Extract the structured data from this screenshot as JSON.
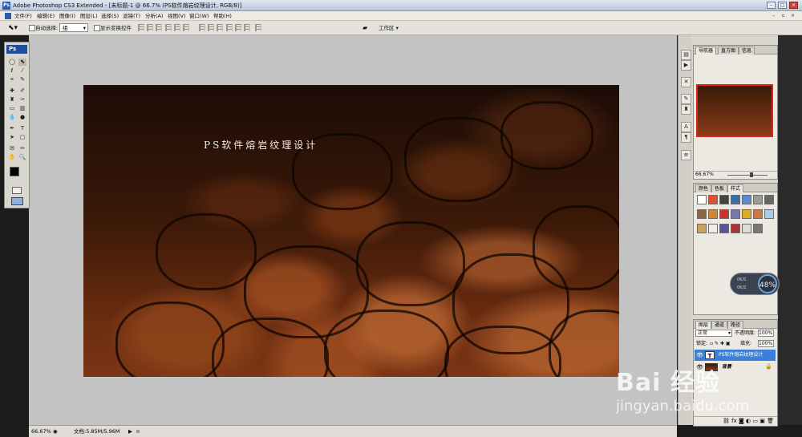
{
  "window": {
    "title": "Adobe Photoshop CS3 Extended - [未标题-1 @ 66.7% (PS软件熔岩纹理设计, RGB/8)]",
    "app_badge": "Ps"
  },
  "menubar": {
    "items": [
      "文件(F)",
      "编辑(E)",
      "图像(I)",
      "图层(L)",
      "选择(S)",
      "滤镜(T)",
      "分析(A)",
      "视图(V)",
      "窗口(W)",
      "帮助(H)"
    ]
  },
  "options": {
    "auto_select_label": "自动选择:",
    "auto_select_value": "组",
    "show_transform_label": "显示变换控件",
    "workspace_label": "工作区 ▾"
  },
  "canvas": {
    "title_text": "PS软件熔岩纹理设计"
  },
  "navigator": {
    "tabs": [
      "导航器",
      "直方图",
      "信息"
    ],
    "zoom": "66.67%"
  },
  "swatches_panel": {
    "tabs": [
      "颜色",
      "色板",
      "样式"
    ],
    "colors": [
      "#ffffff",
      "#e05030",
      "#444444",
      "#3a6ea8",
      "#5a8ad0",
      "#999999",
      "#666666",
      "#886644",
      "#cc8833",
      "#d03030",
      "#7777aa",
      "#ddaa22",
      "#cc7744",
      "#aac8e8",
      "#c8a060",
      "#eeeeee",
      "#555599",
      "#aa3333",
      "#dddddd",
      "#777777"
    ]
  },
  "layers_panel": {
    "tabs": [
      "图层",
      "通道",
      "路径"
    ],
    "blend_mode": "正常",
    "opacity_label": "不透明度:",
    "opacity_value": "100%",
    "lock_label": "锁定:",
    "fill_label": "填充:",
    "fill_value": "100%",
    "layers": [
      {
        "name": "PS软件熔岩纹理设计",
        "type": "text",
        "selected": true
      },
      {
        "name": "背景",
        "type": "image",
        "selected": false
      }
    ]
  },
  "widget": {
    "upload": "0K/S",
    "download": "0K/S",
    "percent": "48%"
  },
  "status": {
    "zoom": "66.67%",
    "doc_info": "文档:5.85M/5.96M"
  },
  "watermark": {
    "brand": "Bai 经验",
    "url": "jingyan.baidu.com"
  },
  "colors": {
    "selected_layer": "#3b7fd8",
    "foreground": "#000000",
    "background": "#ffffff"
  }
}
